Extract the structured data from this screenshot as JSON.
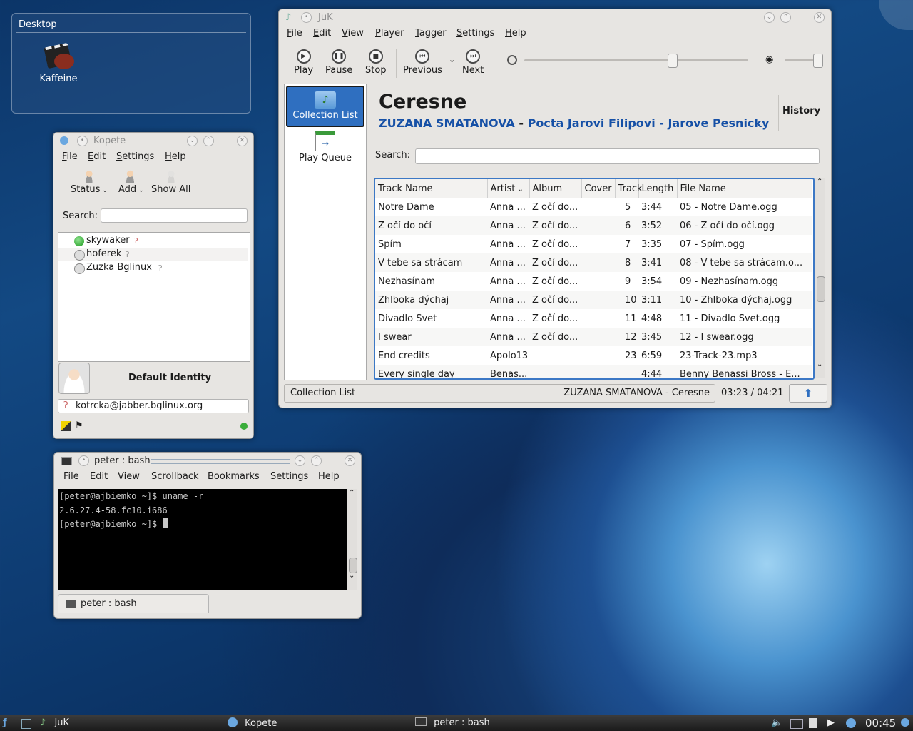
{
  "desktop_widget": {
    "title": "Desktop",
    "icons": [
      {
        "label": "Kaffeine",
        "icon": "kaffeine-icon"
      }
    ]
  },
  "kopete": {
    "title": "Kopete",
    "menu": [
      "File",
      "Edit",
      "Settings",
      "Help"
    ],
    "toolbar": {
      "status": "Status",
      "add": "Add",
      "show_all": "Show All"
    },
    "search_label": "Search:",
    "search_value": "",
    "contacts": [
      {
        "name": "skywaker",
        "status": "online"
      },
      {
        "name": "hoferek",
        "status": "offline"
      },
      {
        "name": "Zuzka Bglinux",
        "status": "offline"
      }
    ],
    "identity": "Default Identity",
    "account": "kotrcka@jabber.bglinux.org"
  },
  "terminal": {
    "title": "peter : bash",
    "menu": [
      "File",
      "Edit",
      "View",
      "Scrollback",
      "Bookmarks",
      "Settings",
      "Help"
    ],
    "lines": [
      "[peter@ajbiemko ~]$ uname -r",
      "2.6.27.4-58.fc10.i686",
      "[peter@ajbiemko ~]$ "
    ],
    "tab_label": "peter : bash"
  },
  "juk": {
    "title": "JuK",
    "menu": [
      "File",
      "Edit",
      "View",
      "Player",
      "Tagger",
      "Settings",
      "Help"
    ],
    "toolbar": {
      "play": "Play",
      "pause": "Pause",
      "stop": "Stop",
      "previous": "Previous",
      "next": "Next"
    },
    "seek_position": 0.66,
    "volume_level": 0.92,
    "sidebar": {
      "collection": "Collection List",
      "queue": "Play Queue"
    },
    "now_playing": {
      "title": "Ceresne",
      "artist": "ZUZANA SMATANOVA",
      "separator": "-",
      "album": "Pocta Jarovi Filipovi - Jarove Pesnicky",
      "history_label": "History"
    },
    "search_label": "Search:",
    "search_value": "",
    "columns": [
      "Track Name",
      "Artist",
      "Album",
      "Cover",
      "Track",
      "Length",
      "File Name"
    ],
    "rows": [
      {
        "track_name": "Notre Dame",
        "artist": "Anna ...",
        "album": "Z očí do...",
        "cover": "",
        "track": "5",
        "length": "3:44",
        "file": "05 - Notre Dame.ogg"
      },
      {
        "track_name": "Z očí do očí",
        "artist": "Anna ...",
        "album": "Z očí do...",
        "cover": "",
        "track": "6",
        "length": "3:52",
        "file": "06 - Z očí do očí.ogg"
      },
      {
        "track_name": "Spím",
        "artist": "Anna ...",
        "album": "Z očí do...",
        "cover": "",
        "track": "7",
        "length": "3:35",
        "file": "07 - Spím.ogg"
      },
      {
        "track_name": "V tebe sa strácam",
        "artist": "Anna ...",
        "album": "Z očí do...",
        "cover": "",
        "track": "8",
        "length": "3:41",
        "file": "08 - V tebe sa strácam.o..."
      },
      {
        "track_name": "Nezhasínam",
        "artist": "Anna ...",
        "album": "Z očí do...",
        "cover": "",
        "track": "9",
        "length": "3:54",
        "file": "09 - Nezhasínam.ogg"
      },
      {
        "track_name": "Zhlboka dýchaj",
        "artist": "Anna ...",
        "album": "Z očí do...",
        "cover": "",
        "track": "10",
        "length": "3:11",
        "file": "10 - Zhlboka dýchaj.ogg"
      },
      {
        "track_name": "Divadlo Svet",
        "artist": "Anna ...",
        "album": "Z očí do...",
        "cover": "",
        "track": "11",
        "length": "4:48",
        "file": "11 - Divadlo Svet.ogg"
      },
      {
        "track_name": "I swear",
        "artist": "Anna ...",
        "album": "Z očí do...",
        "cover": "",
        "track": "12",
        "length": "3:45",
        "file": "12 - I swear.ogg"
      },
      {
        "track_name": "End credits",
        "artist": "Apolo13",
        "album": "",
        "cover": "",
        "track": "23",
        "length": "6:59",
        "file": "23-Track-23.mp3"
      },
      {
        "track_name": "Every single day",
        "artist": "Benas...",
        "album": "",
        "cover": "",
        "track": "",
        "length": "4:44",
        "file": "Benny Benassi Bross - E..."
      }
    ],
    "status": {
      "playlist": "Collection List",
      "playing": "ZUZANA SMATANOVA - Ceresne",
      "time": "03:23 / 04:21"
    }
  },
  "taskbar": {
    "tasks": [
      {
        "label": "JuK"
      },
      {
        "label": "Kopete"
      },
      {
        "label": "peter : bash"
      }
    ],
    "clock": "00:45"
  },
  "colors": {
    "selection": "#2f6fc0",
    "link": "#1650a6",
    "terminal_bg": "#000000"
  }
}
